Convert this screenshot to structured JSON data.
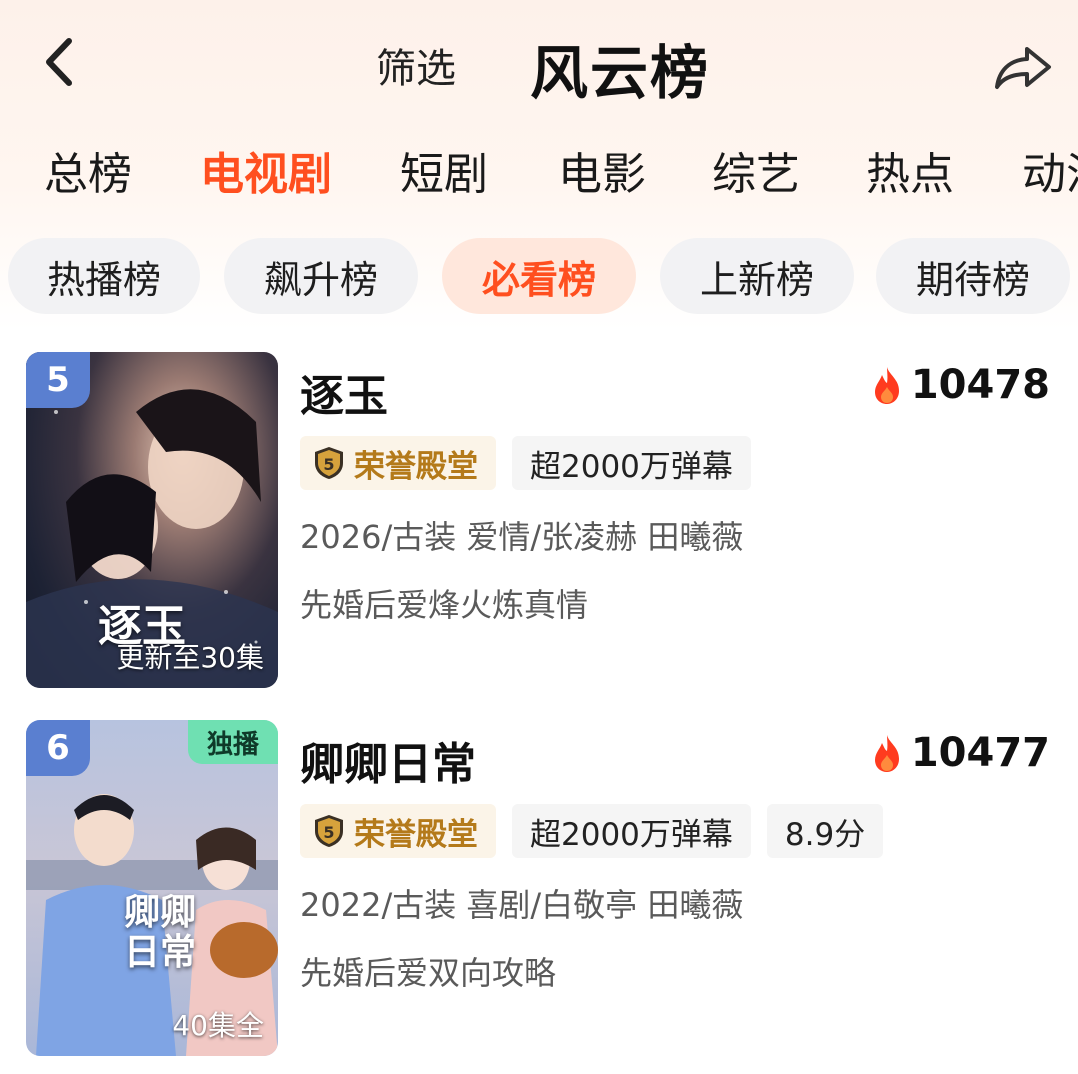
{
  "header": {
    "filter_label": "筛选",
    "title": "风云榜"
  },
  "category_tabs": [
    {
      "label": "总榜",
      "active": false
    },
    {
      "label": "电视剧",
      "active": true
    },
    {
      "label": "短剧",
      "active": false
    },
    {
      "label": "电影",
      "active": false
    },
    {
      "label": "综艺",
      "active": false
    },
    {
      "label": "热点",
      "active": false
    },
    {
      "label": "动漫",
      "active": false
    }
  ],
  "sub_tabs": [
    {
      "label": "热播榜",
      "active": false
    },
    {
      "label": "飙升榜",
      "active": false
    },
    {
      "label": "必看榜",
      "active": true
    },
    {
      "label": "上新榜",
      "active": false
    },
    {
      "label": "期待榜",
      "active": false
    }
  ],
  "items": [
    {
      "rank": "5",
      "poster_title": "逐玉",
      "episode_status": "更新至30集",
      "exclusive": "",
      "title": "逐玉",
      "heat": "10478",
      "tags": [
        "荣誉殿堂",
        "超2000万弹幕"
      ],
      "meta": "2026/古装 爱情/张凌赫 田曦薇",
      "desc": "先婚后爱烽火炼真情"
    },
    {
      "rank": "6",
      "poster_title": "卿卿日常",
      "episode_status": "40集全",
      "exclusive": "独播",
      "title": "卿卿日常",
      "heat": "10477",
      "tags": [
        "荣誉殿堂",
        "超2000万弹幕",
        "8.9分"
      ],
      "meta": "2022/古装 喜剧/白敬亭 田曦薇",
      "desc": "先婚后爱双向攻略"
    }
  ],
  "colors": {
    "accent": "#ff4f1f",
    "rank_badge": "#5a7fd0",
    "exclusive_badge": "#6fe0b2",
    "honor_text": "#b47a1a"
  },
  "icons": {
    "back": "chevron-left-icon",
    "share": "share-arrow-icon",
    "heat": "flame-icon",
    "honor": "shield-badge-icon"
  }
}
